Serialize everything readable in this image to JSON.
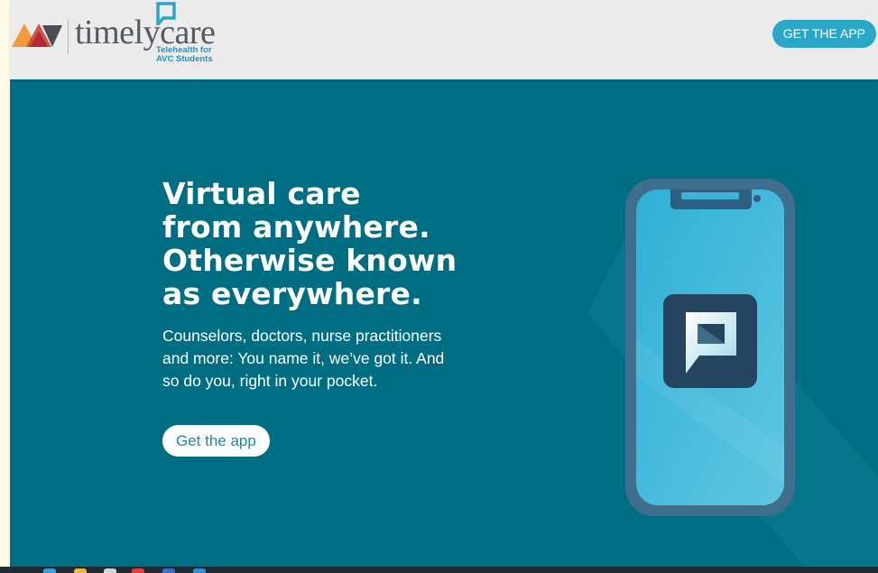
{
  "header": {
    "logo": {
      "word_main": "timely",
      "word_accent": "care",
      "subtitle_line1": "Telehealth for",
      "subtitle_line2": "AVC Students"
    },
    "cta_label": "GET THE APP"
  },
  "hero": {
    "title_lines": [
      "Virtual care",
      "from anywhere.",
      "Otherwise known",
      "as everywhere."
    ],
    "body": "Counselors, doctors, nurse practitioners and more: You name it, we’ve got it. And so do you, right in your pocket.",
    "cta_label": "Get the app"
  },
  "colors": {
    "header_bg": "#ebebeb",
    "hero_bg": "#006e82",
    "accent_blue": "#2aa6c7",
    "logo_blue": "#1f96c4",
    "logo_orange": "#f29b38",
    "logo_red": "#b5283a",
    "phone_frame": "#3f6e8d",
    "phone_screen": "#3bb4d8",
    "app_tile": "#24445f"
  },
  "icons": {
    "logo_mark": "avc-chevrons-icon",
    "logo_square": "timelycare-square-icon",
    "phone_app": "timelycare-app-icon"
  }
}
